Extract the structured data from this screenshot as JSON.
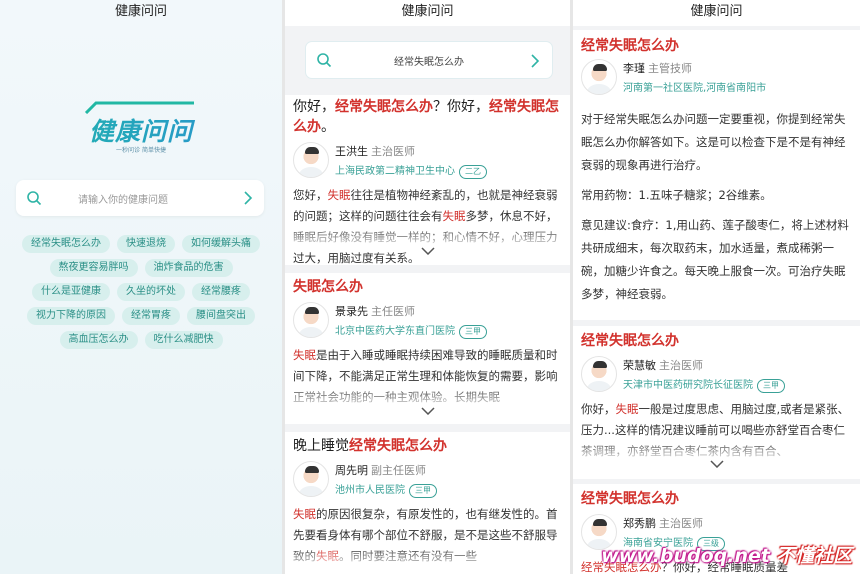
{
  "app_title": "健康问问",
  "home": {
    "logo_text": "健康问问",
    "logo_slogan": "一秒问诊 简单快捷",
    "search_placeholder": "请输入你的健康问题",
    "hot_tags": [
      [
        "经常失眠怎么办",
        "快速退烧",
        "如何缓解头痛"
      ],
      [
        "熬夜更容易胖吗",
        "油炸食品的危害"
      ],
      [
        "什么是亚健康",
        "久坐的坏处",
        "经常腰疼"
      ],
      [
        "视力下降的原因",
        "经常胃疼",
        "腰间盘突出"
      ],
      [
        "高血压怎么办",
        "吃什么减肥快"
      ]
    ]
  },
  "results": {
    "search_query": "经常失眠怎么办",
    "cards": [
      {
        "title_parts": [
          "你好，",
          "经常失眠怎么办",
          "？你好，",
          "经常失眠怎么办",
          "。"
        ],
        "doctor_name": "王洪生",
        "doctor_title": "主治医师",
        "hospital": "上海民政第二精神卫生中心",
        "grade": "二乙",
        "body_parts": [
          "您好，",
          "失眠",
          "往往是植物神经紊乱的，也就是神经衰弱的问题；这样的问题往往会有",
          "失眠",
          "多梦，休息不好，睡眠后好像没有睡觉一样的；和心情不好，心理压力过大，用脑过度有关系。"
        ]
      },
      {
        "title_parts": [
          "失眠怎么办"
        ],
        "doctor_name": "景录先",
        "doctor_title": "主任医师",
        "hospital": "北京中医药大学东直门医院",
        "grade": "三甲",
        "body_parts": [
          "失眠",
          "是由于入睡或睡眠持续困难导致的睡眠质量和时间下降，不能满足正常生理和体能恢复的需要，影响正常社会功能的一种主观体验。长期失眠"
        ]
      },
      {
        "title_parts": [
          "晚上睡觉",
          "经常失眠怎么办"
        ],
        "doctor_name": "周先明",
        "doctor_title": "副主任医师",
        "hospital": "池州市人民医院",
        "grade": "三甲",
        "body_parts": [
          "失眠",
          "的原因很复杂，有原发性的，也有继发性的。首先要看身体有哪个部位不舒服，是不是这些不舒服导致的",
          "失眠",
          "。同时要注意还有没有一些"
        ]
      }
    ]
  },
  "detail": {
    "title": "经常失眠怎么办",
    "doctor_name": "李瑾",
    "doctor_title": "主管技师",
    "hospital": "河南第一社区医院,河南省南阳市",
    "paragraphs": [
      "对于经常失眠怎么办问题一定要重视，你提到经常失眠怎么办你解答如下。这是可以检查下是不是有神经衰弱的现象再进行治疗。",
      "常用药物：1.五味子糖浆；2谷维素。",
      "意见建议:食疗：1,用山药、莲子酸枣仁，将上述材料共研成细末，每次取药末，加水适量，煮成稀粥一碗，加糖少许食之。每天晚上服食一次。可治疗失眠多梦，神经衰弱。"
    ],
    "related": [
      {
        "title": "经常失眠怎么办",
        "doctor_name": "荣慧敏",
        "doctor_title": "主治医师",
        "hospital": "天津市中医药研究院长征医院",
        "grade": "三甲",
        "body_parts": [
          "你好，",
          "失眠",
          "一般是过度思虑、用脑过度,或者是紧张、压力...这样的情况建议睡前可以喝些亦舒堂百合枣仁茶调理，亦舒堂百合枣仁茶内含有百合、"
        ]
      },
      {
        "title": "经常失眠怎么办",
        "doctor_name": "郑秀鹏",
        "doctor_title": "主治医师",
        "hospital": "海南省安宁医院",
        "grade": "三级",
        "body_parts": [
          "经常失眠怎么办",
          "？你好，经常睡眠质量差"
        ]
      }
    ]
  },
  "watermark": {
    "site": "www.budoq.net",
    "brand": "不懂社区"
  },
  "colors": {
    "accent": "#3aa197",
    "highlight": "#d2322d",
    "tag_bg": "#d7efed"
  }
}
